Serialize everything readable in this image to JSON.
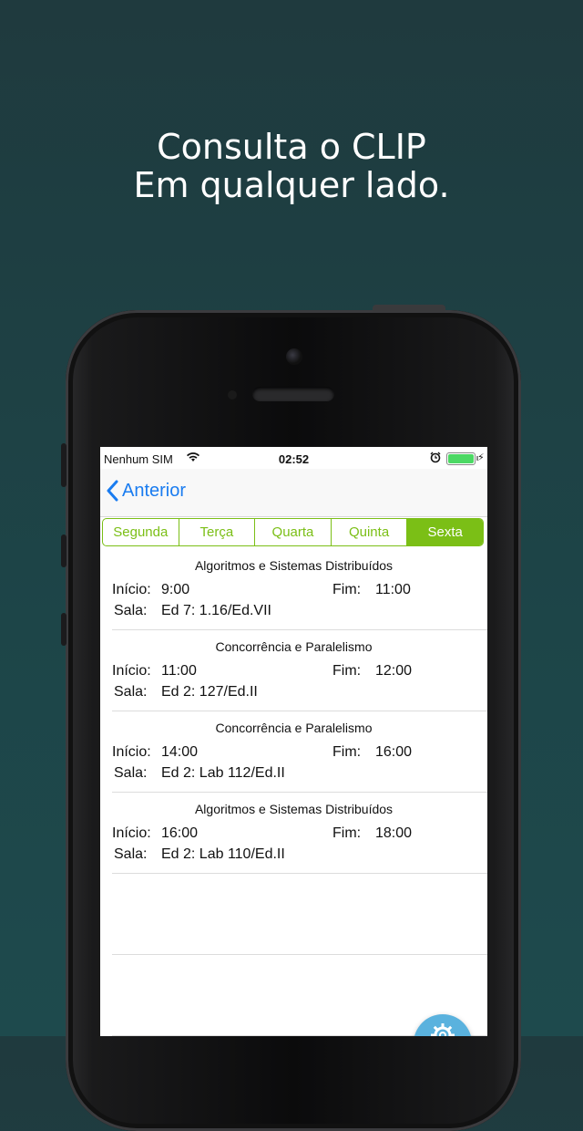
{
  "headline": {
    "line1": "Consulta o CLIP",
    "line2": "Em qualquer lado."
  },
  "status_bar": {
    "carrier": "Nenhum SIM",
    "time": "02:52",
    "battery_level": 1.0
  },
  "navbar": {
    "back_label": "Anterior"
  },
  "days": [
    "Segunda",
    "Terça",
    "Quarta",
    "Quinta",
    "Sexta"
  ],
  "selected_day": "Sexta",
  "labels": {
    "start": "Início:",
    "end": "Fim:",
    "room": "Sala:"
  },
  "classes": [
    {
      "name": "Algoritmos e Sistemas Distribuídos",
      "start": "9:00",
      "end": "11:00",
      "room": "Ed 7: 1.16/Ed.VII"
    },
    {
      "name": "Concorrência e Paralelismo",
      "start": "11:00",
      "end": "12:00",
      "room": "Ed 2: 127/Ed.II"
    },
    {
      "name": "Concorrência e Paralelismo",
      "start": "14:00",
      "end": "16:00",
      "room": "Ed 2: Lab 112/Ed.II"
    },
    {
      "name": "Algoritmos e Sistemas Distribuídos",
      "start": "16:00",
      "end": "18:00",
      "room": "Ed 2: Lab 110/Ed.II"
    }
  ],
  "colors": {
    "accent_green": "#7bbf16",
    "link_blue": "#1a7cf0",
    "fab_blue": "#5ab2de"
  }
}
